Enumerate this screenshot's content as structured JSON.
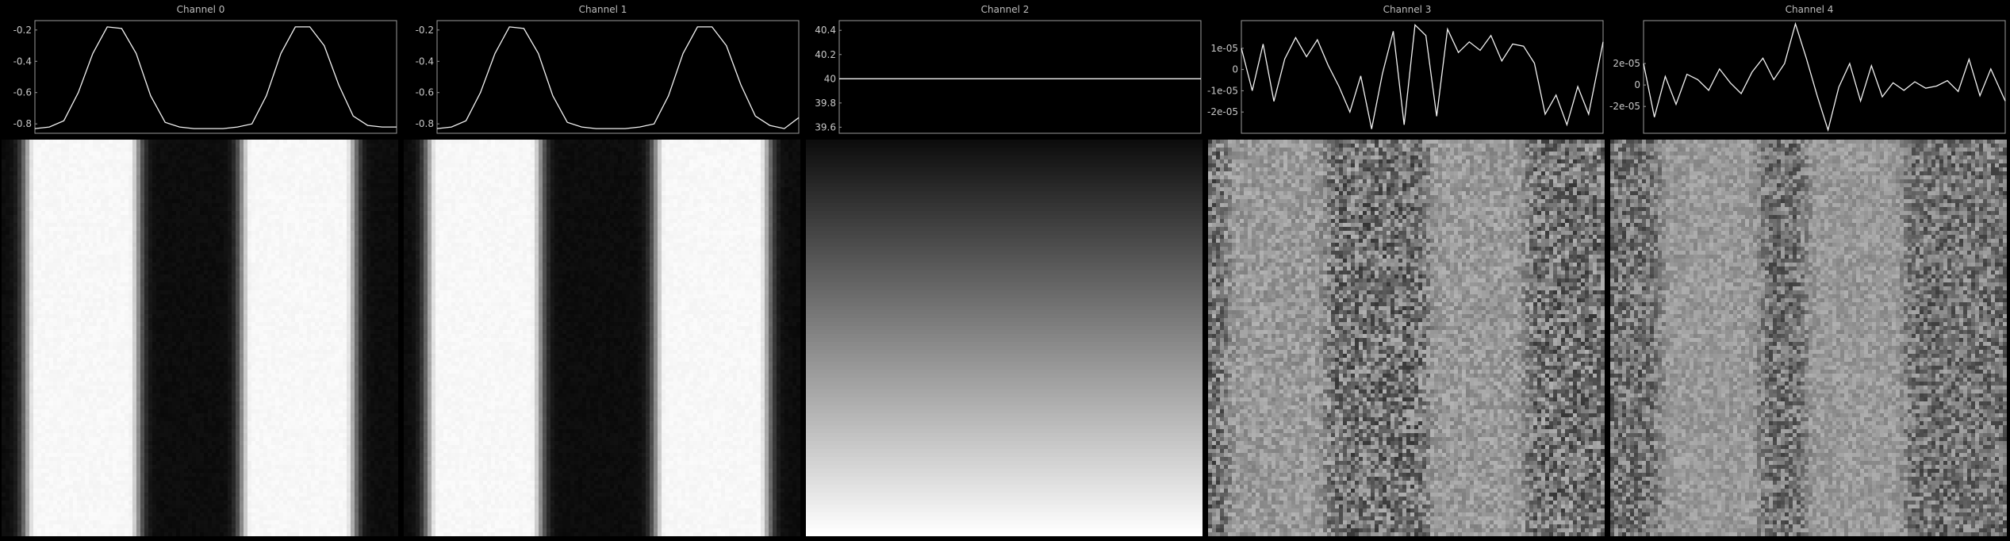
{
  "chart_data": [
    {
      "type": "line",
      "title": "Channel 0",
      "yticks": [
        "-0.2",
        "-0.4",
        "-0.6",
        "-0.8"
      ],
      "ylim": [
        -0.86,
        -0.14
      ],
      "x": [
        0,
        4,
        8,
        12,
        16,
        20,
        24,
        28,
        32,
        36,
        40,
        44,
        48,
        52,
        56,
        60,
        64,
        68,
        72,
        76,
        80,
        84,
        88,
        92,
        96,
        100
      ],
      "values": [
        -0.83,
        -0.82,
        -0.78,
        -0.6,
        -0.35,
        -0.18,
        -0.19,
        -0.35,
        -0.62,
        -0.79,
        -0.82,
        -0.83,
        -0.83,
        -0.83,
        -0.82,
        -0.8,
        -0.62,
        -0.35,
        -0.18,
        -0.18,
        -0.3,
        -0.55,
        -0.75,
        -0.81,
        -0.82,
        -0.82
      ],
      "heatmap": {
        "kind": "bands",
        "bands": [
          0.2,
          0.75
        ],
        "width": 0.12,
        "noise": 0.03
      }
    },
    {
      "type": "line",
      "title": "Channel 1",
      "yticks": [
        "-0.2",
        "-0.4",
        "-0.6",
        "-0.8"
      ],
      "ylim": [
        -0.86,
        -0.14
      ],
      "x": [
        0,
        4,
        8,
        12,
        16,
        20,
        24,
        28,
        32,
        36,
        40,
        44,
        48,
        52,
        56,
        60,
        64,
        68,
        72,
        76,
        80,
        84,
        88,
        92,
        96,
        100
      ],
      "values": [
        -0.83,
        -0.82,
        -0.78,
        -0.6,
        -0.35,
        -0.18,
        -0.19,
        -0.35,
        -0.62,
        -0.79,
        -0.82,
        -0.83,
        -0.83,
        -0.83,
        -0.82,
        -0.8,
        -0.62,
        -0.35,
        -0.18,
        -0.18,
        -0.3,
        -0.55,
        -0.75,
        -0.81,
        -0.83,
        -0.76
      ],
      "heatmap": {
        "kind": "bands",
        "bands": [
          0.2,
          0.78
        ],
        "width": 0.12,
        "noise": 0.03
      }
    },
    {
      "type": "line",
      "title": "Channel 2",
      "yticks": [
        "40.4",
        "40.2",
        "40",
        "39.8",
        "39.6"
      ],
      "ylim": [
        39.55,
        40.48
      ],
      "x": [
        0,
        100
      ],
      "values": [
        40,
        40
      ],
      "heatmap": {
        "kind": "gradient"
      }
    },
    {
      "type": "line",
      "title": "Channel 3",
      "yticks": [
        "1e-05",
        "0",
        "-1e-05",
        "-2e-05"
      ],
      "ylim": [
        -3e-05,
        2.3e-05
      ],
      "x": [
        0,
        3,
        6,
        9,
        12,
        15,
        18,
        21,
        24,
        27,
        30,
        33,
        36,
        39,
        42,
        45,
        48,
        51,
        54,
        57,
        60,
        63,
        66,
        69,
        72,
        75,
        78,
        81,
        84,
        87,
        90,
        93,
        96,
        100
      ],
      "values": [
        1e-05,
        -1e-05,
        1.2e-05,
        -1.5e-05,
        5e-06,
        1.5e-05,
        6e-06,
        1.4e-05,
        2e-06,
        -8e-06,
        -2e-05,
        -3e-06,
        -2.8e-05,
        -2e-06,
        1.8e-05,
        -2.6e-05,
        2.1e-05,
        1.6e-05,
        -2.2e-05,
        1.9e-05,
        8e-06,
        1.3e-05,
        9e-06,
        1.6e-05,
        4e-06,
        1.2e-05,
        1.1e-05,
        3e-06,
        -2.1e-05,
        -1.2e-05,
        -2.6e-05,
        -8e-06,
        -2.1e-05,
        1.3e-05
      ],
      "heatmap": {
        "kind": "noise",
        "bands": [
          0.17,
          0.68
        ],
        "width": 0.1,
        "noise": 0.35
      }
    },
    {
      "type": "line",
      "title": "Channel 4",
      "yticks": [
        "2e-05",
        "0",
        "-2e-05"
      ],
      "ylim": [
        -4.5e-05,
        6e-05
      ],
      "x": [
        0,
        3,
        6,
        9,
        12,
        15,
        18,
        21,
        24,
        27,
        30,
        33,
        36,
        39,
        42,
        45,
        48,
        51,
        54,
        57,
        60,
        63,
        66,
        69,
        72,
        75,
        78,
        81,
        84,
        87,
        90,
        93,
        96,
        100
      ],
      "values": [
        2e-05,
        -3e-05,
        8e-06,
        -1.8e-05,
        1e-05,
        5e-06,
        -5e-06,
        1.5e-05,
        2e-06,
        -8e-06,
        1.2e-05,
        2.5e-05,
        5e-06,
        2e-05,
        5.7e-05,
        2.5e-05,
        -1e-05,
        -4.2e-05,
        -2e-06,
        2e-05,
        -1.5e-05,
        1.8e-05,
        -1.1e-05,
        2e-06,
        -5e-06,
        3e-06,
        -3e-06,
        -1e-06,
        4e-06,
        -6e-06,
        2.4e-05,
        -1e-05,
        1.5e-05,
        -1.5e-05
      ],
      "heatmap": {
        "kind": "noise",
        "bands": [
          0.25,
          0.62
        ],
        "width": 0.1,
        "noise": 0.3
      }
    }
  ]
}
